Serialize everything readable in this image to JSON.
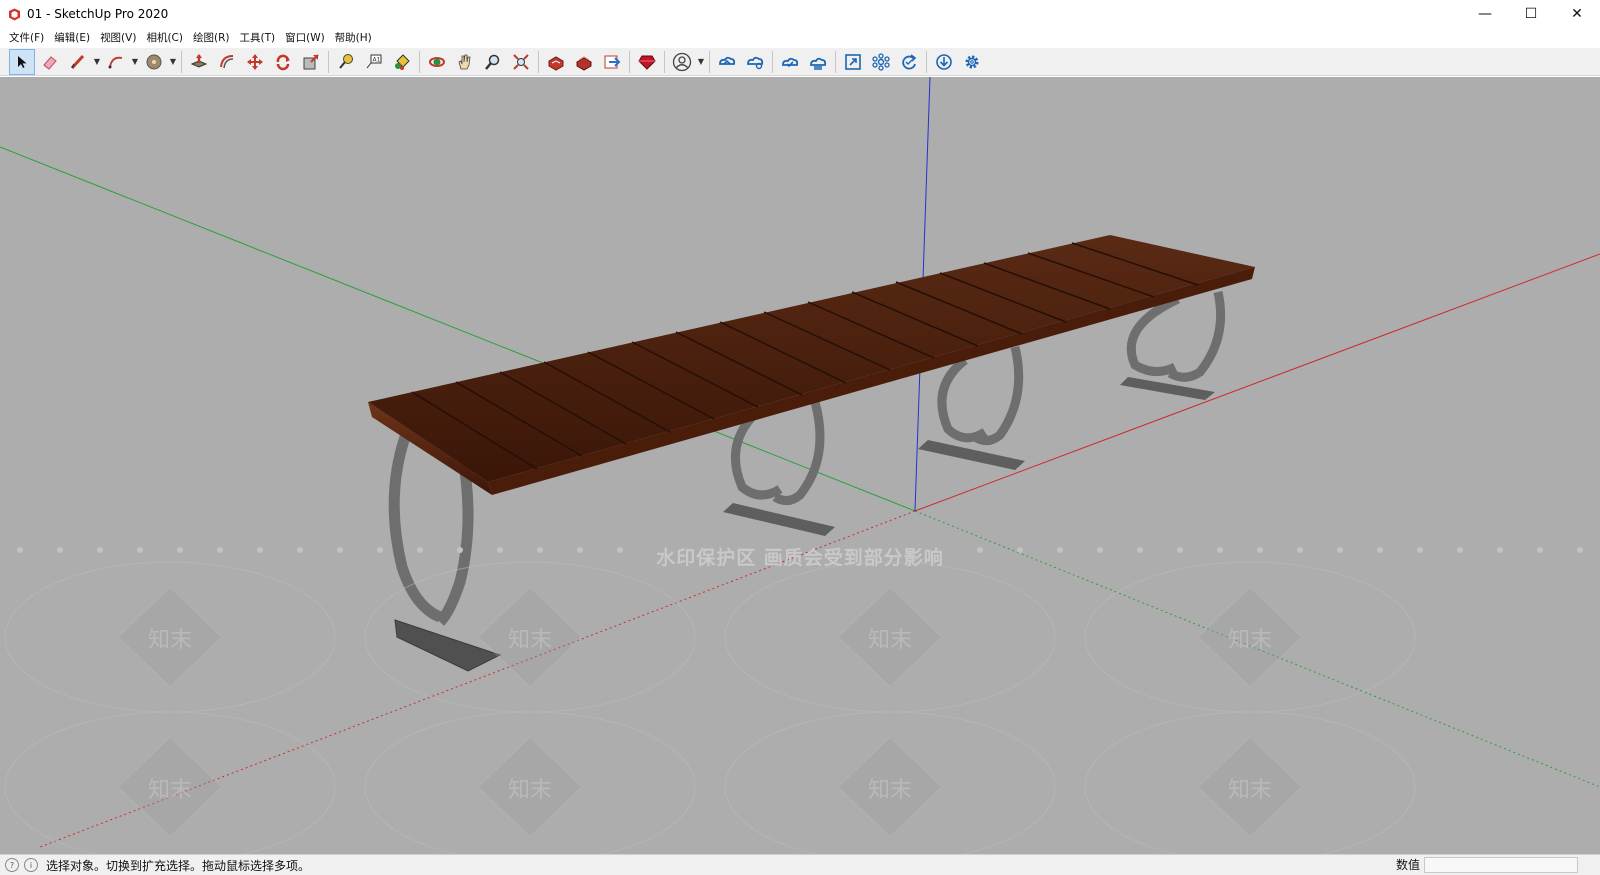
{
  "window": {
    "title": "01 - SketchUp Pro 2020",
    "minimize": "—",
    "maximize": "☐",
    "close": "✕"
  },
  "menu": [
    "文件(F)",
    "编辑(E)",
    "视图(V)",
    "相机(C)",
    "绘图(R)",
    "工具(T)",
    "窗口(W)",
    "帮助(H)"
  ],
  "toolbar": {
    "icons": [
      "select-tool-icon",
      "eraser-tool-icon",
      "pencil-line-tool-icon",
      "arc-tool-icon",
      "shapes-tool-icon",
      "push-pull-tool-icon",
      "offset-tool-icon",
      "move-tool-icon",
      "rotate-tool-icon",
      "scale-tool-icon",
      "tape-measure-tool-icon",
      "text-tool-icon",
      "paint-bucket-tool-icon",
      "orbit-tool-icon",
      "pan-tool-icon",
      "zoom-tool-icon",
      "zoom-extents-tool-icon",
      "warehouse-icon",
      "extension-warehouse-icon",
      "send-to-layout-icon",
      "ruby-console-icon",
      "profile-icon",
      "trimble-connect-icon",
      "trimble-share-icon",
      "cloud-sync-icon",
      "cloud-publish-icon",
      "view-fit-icon",
      "components-icon",
      "refresh-icon",
      "download-icon",
      "settings-gear-icon"
    ]
  },
  "viewport": {
    "watermark_banner": "水印保护区   画质会受到部分影响",
    "watermark_tile": "知末"
  },
  "status": {
    "text": "选择对象。切换到扩充选择。拖动鼠标选择多项。",
    "measurements_label": "数值",
    "measurements_value": ""
  }
}
